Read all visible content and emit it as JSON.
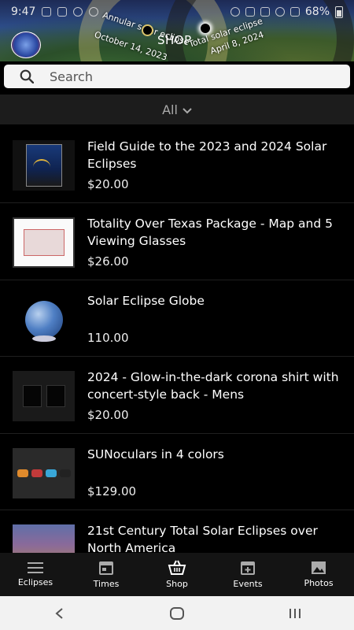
{
  "status_bar": {
    "time": "9:47",
    "battery": "68%"
  },
  "banner": {
    "shop_title": "SHOP",
    "annular_label": "Annular solar eclipse",
    "annular_date": "October 14, 2023",
    "total_label": "Total solar eclipse",
    "total_date": "April 8, 2024"
  },
  "search": {
    "placeholder": "Search",
    "value": ""
  },
  "filter": {
    "label": "All"
  },
  "products": [
    {
      "title": "Field Guide to the 2023 and 2024 Solar Eclipses",
      "price": "$20.00"
    },
    {
      "title": "Totality Over Texas Package - Map and 5 Viewing Glasses",
      "price": "$26.00"
    },
    {
      "title": "Solar Eclipse Globe",
      "price": "110.00"
    },
    {
      "title": "2024 - Glow-in-the-dark corona shirt with concert-style back - Mens",
      "price": "$20.00"
    },
    {
      "title": "SUNoculars in 4 colors",
      "price": "$129.00"
    },
    {
      "title": "21st Century Total Solar Eclipses over North America",
      "price": ""
    }
  ],
  "bottom_nav": {
    "eclipses": "Eclipses",
    "times": "Times",
    "shop": "Shop",
    "events": "Events",
    "photos": "Photos"
  },
  "colors": {
    "background": "#000000",
    "nav_background": "#141414",
    "search_background": "#f4f4f4"
  }
}
